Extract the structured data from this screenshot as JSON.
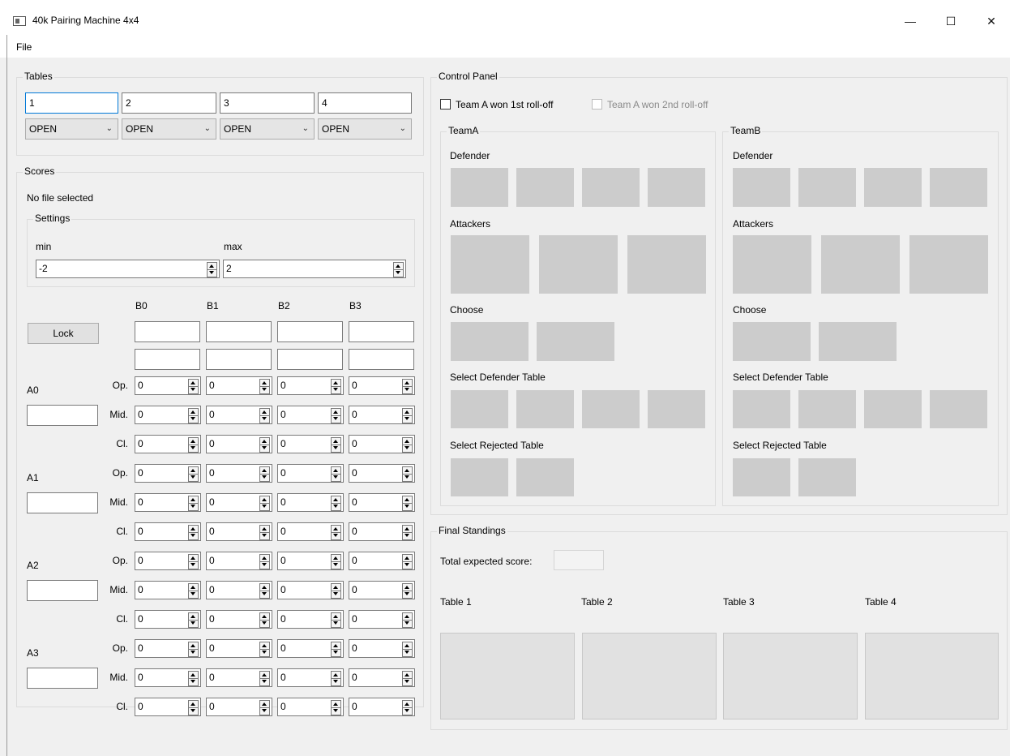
{
  "window": {
    "title": "40k Pairing Machine 4x4",
    "minimize_icon": "minimize-icon",
    "maximize_icon": "maximize-icon",
    "close_icon": "close-icon"
  },
  "menu": {
    "file": "File"
  },
  "tables": {
    "group_title": "Tables",
    "names": [
      "1",
      "2",
      "3",
      "4"
    ],
    "statuses": [
      "OPEN",
      "OPEN",
      "OPEN",
      "OPEN"
    ]
  },
  "scores": {
    "group_title": "Scores",
    "file_status": "No file selected",
    "settings": {
      "group_title": "Settings",
      "min_label": "min",
      "max_label": "max",
      "min_value": "-2",
      "max_value": "2"
    },
    "lock_label": "Lock",
    "columns": [
      "B0",
      "B1",
      "B2",
      "B3"
    ],
    "b_names_row1": [
      "",
      "",
      "",
      ""
    ],
    "b_names_row2": [
      "",
      "",
      "",
      ""
    ],
    "rows": [
      {
        "label": "A0",
        "name": "",
        "op_label": "Op.",
        "mid_label": "Mid.",
        "cl_label": "Cl.",
        "op": [
          "0",
          "0",
          "0",
          "0"
        ],
        "mid": [
          "0",
          "0",
          "0",
          "0"
        ],
        "cl": [
          "0",
          "0",
          "0",
          "0"
        ]
      },
      {
        "label": "A1",
        "name": "",
        "op_label": "Op.",
        "mid_label": "Mid.",
        "cl_label": "Cl.",
        "op": [
          "0",
          "0",
          "0",
          "0"
        ],
        "mid": [
          "0",
          "0",
          "0",
          "0"
        ],
        "cl": [
          "0",
          "0",
          "0",
          "0"
        ]
      },
      {
        "label": "A2",
        "name": "",
        "op_label": "Op.",
        "mid_label": "Mid.",
        "cl_label": "Cl.",
        "op": [
          "0",
          "0",
          "0",
          "0"
        ],
        "mid": [
          "0",
          "0",
          "0",
          "0"
        ],
        "cl": [
          "0",
          "0",
          "0",
          "0"
        ]
      },
      {
        "label": "A3",
        "name": "",
        "op_label": "Op.",
        "mid_label": "Mid.",
        "cl_label": "Cl.",
        "op": [
          "0",
          "0",
          "0",
          "0"
        ],
        "mid": [
          "0",
          "0",
          "0",
          "0"
        ],
        "cl": [
          "0",
          "0",
          "0",
          "0"
        ]
      }
    ]
  },
  "control_panel": {
    "group_title": "Control Panel",
    "rolloff1_label": "Team A won 1st roll-off",
    "rolloff1_checked": false,
    "rolloff2_label": "Team A won 2nd roll-off",
    "rolloff2_checked": false,
    "rolloff2_enabled": false,
    "team_a": {
      "group_title": "TeamA",
      "defender": "Defender",
      "attackers": "Attackers",
      "choose": "Choose",
      "select_defender_table": "Select Defender Table",
      "select_rejected_table": "Select Rejected Table"
    },
    "team_b": {
      "group_title": "TeamB",
      "defender": "Defender",
      "attackers": "Attackers",
      "choose": "Choose",
      "select_defender_table": "Select Defender Table",
      "select_rejected_table": "Select Rejected Table"
    }
  },
  "final_standings": {
    "group_title": "Final Standings",
    "total_label": "Total expected score:",
    "total_value": "",
    "tables": [
      "Table 1",
      "Table 2",
      "Table 3",
      "Table 4"
    ]
  }
}
